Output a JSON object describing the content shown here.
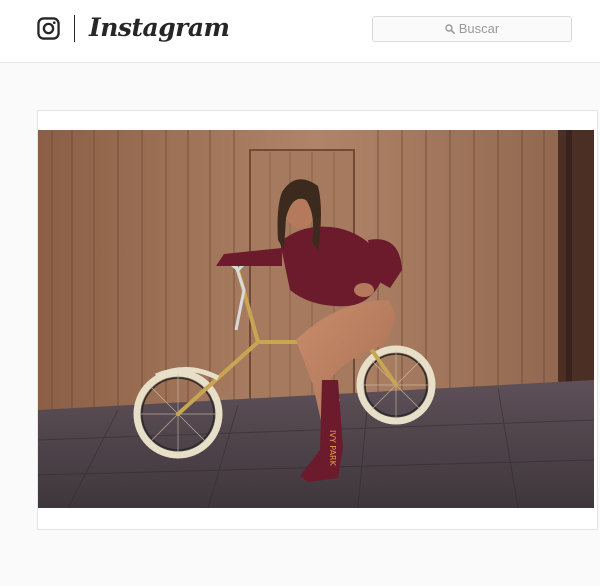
{
  "header": {
    "brand": "Instagram",
    "logo_icon": "instagram-camera-icon",
    "search": {
      "icon": "search-icon",
      "placeholder": "Buscar"
    }
  },
  "post": {
    "image": {
      "subject_text": "IVY PARK"
    }
  },
  "colors": {
    "topbar_bg": "#ffffff",
    "page_bg": "#fafafa",
    "border": "#e6e6e6",
    "text": "#262626",
    "placeholder": "#999999",
    "outfit": "#6b1b2b"
  }
}
